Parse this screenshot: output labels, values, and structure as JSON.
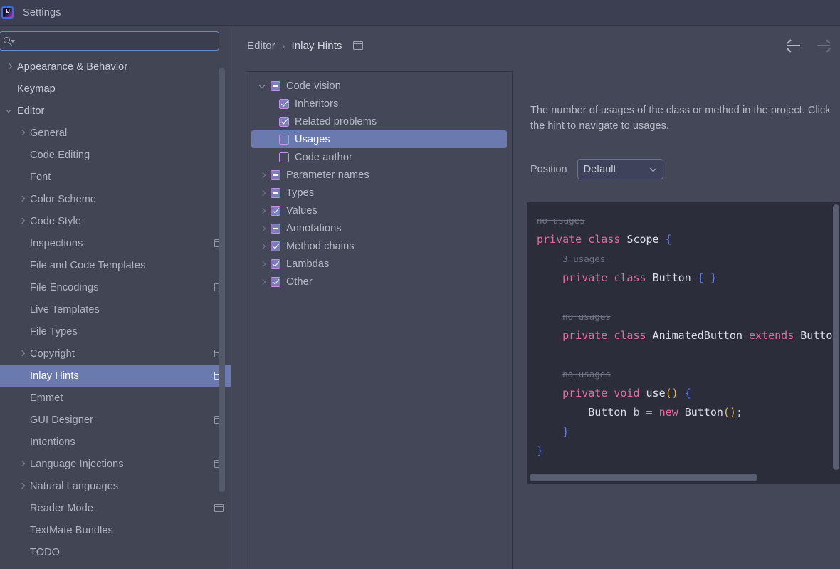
{
  "titlebar": {
    "title": "Settings",
    "icon": "intellij-idea-icon"
  },
  "search": {
    "placeholder": "",
    "value": "",
    "icon": "search-icon"
  },
  "sidebar": {
    "items": [
      {
        "label": "Appearance & Behavior",
        "level": 0,
        "arrow": "right",
        "badge": false,
        "selected": false
      },
      {
        "label": "Keymap",
        "level": 0,
        "arrow": "none",
        "badge": false,
        "selected": false
      },
      {
        "label": "Editor",
        "level": 0,
        "arrow": "down",
        "badge": false,
        "selected": false
      },
      {
        "label": "General",
        "level": 1,
        "arrow": "right",
        "badge": false,
        "selected": false
      },
      {
        "label": "Code Editing",
        "level": 1,
        "arrow": "none",
        "badge": false,
        "selected": false
      },
      {
        "label": "Font",
        "level": 1,
        "arrow": "none",
        "badge": false,
        "selected": false
      },
      {
        "label": "Color Scheme",
        "level": 1,
        "arrow": "right",
        "badge": false,
        "selected": false
      },
      {
        "label": "Code Style",
        "level": 1,
        "arrow": "right",
        "badge": false,
        "selected": false
      },
      {
        "label": "Inspections",
        "level": 1,
        "arrow": "none",
        "badge": true,
        "selected": false
      },
      {
        "label": "File and Code Templates",
        "level": 1,
        "arrow": "none",
        "badge": false,
        "selected": false
      },
      {
        "label": "File Encodings",
        "level": 1,
        "arrow": "none",
        "badge": true,
        "selected": false
      },
      {
        "label": "Live Templates",
        "level": 1,
        "arrow": "none",
        "badge": false,
        "selected": false
      },
      {
        "label": "File Types",
        "level": 1,
        "arrow": "none",
        "badge": false,
        "selected": false
      },
      {
        "label": "Copyright",
        "level": 1,
        "arrow": "right",
        "badge": true,
        "selected": false
      },
      {
        "label": "Inlay Hints",
        "level": 1,
        "arrow": "none",
        "badge": true,
        "selected": true
      },
      {
        "label": "Emmet",
        "level": 1,
        "arrow": "none",
        "badge": false,
        "selected": false
      },
      {
        "label": "GUI Designer",
        "level": 1,
        "arrow": "none",
        "badge": true,
        "selected": false
      },
      {
        "label": "Intentions",
        "level": 1,
        "arrow": "none",
        "badge": false,
        "selected": false
      },
      {
        "label": "Language Injections",
        "level": 1,
        "arrow": "right",
        "badge": true,
        "selected": false
      },
      {
        "label": "Natural Languages",
        "level": 1,
        "arrow": "right",
        "badge": false,
        "selected": false
      },
      {
        "label": "Reader Mode",
        "level": 1,
        "arrow": "none",
        "badge": true,
        "selected": false
      },
      {
        "label": "TextMate Bundles",
        "level": 1,
        "arrow": "none",
        "badge": false,
        "selected": false
      },
      {
        "label": "TODO",
        "level": 1,
        "arrow": "none",
        "badge": false,
        "selected": false
      }
    ]
  },
  "breadcrumb": {
    "parent": "Editor",
    "separator": "›",
    "current": "Inlay Hints",
    "badge": "project-scope-icon"
  },
  "nav": {
    "back": "back-arrow",
    "forward": "forward-arrow"
  },
  "hints_tree": [
    {
      "label": "Code vision",
      "indent": 0,
      "arrow": "down",
      "state": "partial",
      "selected": false
    },
    {
      "label": "Inheritors",
      "indent": 1,
      "arrow": "none",
      "state": "checked",
      "selected": false
    },
    {
      "label": "Related problems",
      "indent": 1,
      "arrow": "none",
      "state": "checked",
      "selected": false
    },
    {
      "label": "Usages",
      "indent": 1,
      "arrow": "none",
      "state": "unchecked",
      "selected": true
    },
    {
      "label": "Code author",
      "indent": 1,
      "arrow": "none",
      "state": "unchecked",
      "selected": false
    },
    {
      "label": "Parameter names",
      "indent": 0,
      "arrow": "right",
      "state": "partial",
      "selected": false
    },
    {
      "label": "Types",
      "indent": 0,
      "arrow": "right",
      "state": "partial",
      "selected": false
    },
    {
      "label": "Values",
      "indent": 0,
      "arrow": "right",
      "state": "checked",
      "selected": false
    },
    {
      "label": "Annotations",
      "indent": 0,
      "arrow": "right",
      "state": "partial",
      "selected": false
    },
    {
      "label": "Method chains",
      "indent": 0,
      "arrow": "right",
      "state": "checked",
      "selected": false
    },
    {
      "label": "Lambdas",
      "indent": 0,
      "arrow": "right",
      "state": "checked",
      "selected": false
    },
    {
      "label": "Other",
      "indent": 0,
      "arrow": "right",
      "state": "checked",
      "selected": false
    }
  ],
  "detail": {
    "description": "The number of usages of the class or method in the project. Click the hint to navigate to usages.",
    "position_label": "Position",
    "position_value": "Default",
    "position_options": [
      "Default"
    ]
  },
  "code_preview": {
    "lines": [
      {
        "indent": 0,
        "hint": "no usages",
        "tokens": []
      },
      {
        "indent": 0,
        "hint": null,
        "tokens": [
          {
            "t": "private",
            "c": "kw"
          },
          {
            "t": " ",
            "c": "pln"
          },
          {
            "t": "class",
            "c": "kw"
          },
          {
            "t": " ",
            "c": "pln"
          },
          {
            "t": "Scope",
            "c": "typ"
          },
          {
            "t": " ",
            "c": "pln"
          },
          {
            "t": "{",
            "c": "br"
          }
        ]
      },
      {
        "indent": 1,
        "hint": "3 usages",
        "tokens": []
      },
      {
        "indent": 1,
        "hint": null,
        "tokens": [
          {
            "t": "private",
            "c": "kw"
          },
          {
            "t": " ",
            "c": "pln"
          },
          {
            "t": "class",
            "c": "kw"
          },
          {
            "t": " ",
            "c": "pln"
          },
          {
            "t": "Button",
            "c": "typ"
          },
          {
            "t": " ",
            "c": "pln"
          },
          {
            "t": "{ }",
            "c": "br"
          }
        ]
      },
      {
        "indent": 0,
        "hint": null,
        "tokens": []
      },
      {
        "indent": 1,
        "hint": "no usages",
        "tokens": []
      },
      {
        "indent": 1,
        "hint": null,
        "tokens": [
          {
            "t": "private",
            "c": "kw"
          },
          {
            "t": " ",
            "c": "pln"
          },
          {
            "t": "class",
            "c": "kw"
          },
          {
            "t": " ",
            "c": "pln"
          },
          {
            "t": "AnimatedButton",
            "c": "typ"
          },
          {
            "t": " ",
            "c": "pln"
          },
          {
            "t": "extends",
            "c": "kw"
          },
          {
            "t": " ",
            "c": "pln"
          },
          {
            "t": "Button",
            "c": "typ"
          }
        ]
      },
      {
        "indent": 0,
        "hint": null,
        "tokens": []
      },
      {
        "indent": 1,
        "hint": "no usages",
        "tokens": []
      },
      {
        "indent": 1,
        "hint": null,
        "tokens": [
          {
            "t": "private",
            "c": "kw"
          },
          {
            "t": " ",
            "c": "pln"
          },
          {
            "t": "void",
            "c": "kw"
          },
          {
            "t": " ",
            "c": "pln"
          },
          {
            "t": "use",
            "c": "typ"
          },
          {
            "t": "()",
            "c": "par"
          },
          {
            "t": " ",
            "c": "pln"
          },
          {
            "t": "{",
            "c": "br"
          }
        ]
      },
      {
        "indent": 2,
        "hint": null,
        "tokens": [
          {
            "t": "Button",
            "c": "typ"
          },
          {
            "t": " b ",
            "c": "pln"
          },
          {
            "t": "=",
            "c": "pln"
          },
          {
            "t": " ",
            "c": "pln"
          },
          {
            "t": "new",
            "c": "kw"
          },
          {
            "t": " ",
            "c": "pln"
          },
          {
            "t": "Button",
            "c": "typ"
          },
          {
            "t": "()",
            "c": "par"
          },
          {
            "t": ";",
            "c": "pln"
          }
        ]
      },
      {
        "indent": 1,
        "hint": null,
        "tokens": [
          {
            "t": "}",
            "c": "br"
          }
        ]
      },
      {
        "indent": 0,
        "hint": null,
        "tokens": [
          {
            "t": "}",
            "c": "br"
          }
        ]
      }
    ]
  },
  "colors": {
    "window_bg": "#434757",
    "titlebar_bg": "#3C3F52",
    "selection_blue": "#6B7AAE",
    "checkbox_accent": "#C98FF0",
    "code_bg": "#2B2D3A",
    "keyword_pink": "#E06C9F",
    "brace_blue": "#637BDE",
    "paren_yellow": "#E2BA4A",
    "hint_gray": "#6E7281",
    "focus_border": "#6B8CC7"
  }
}
